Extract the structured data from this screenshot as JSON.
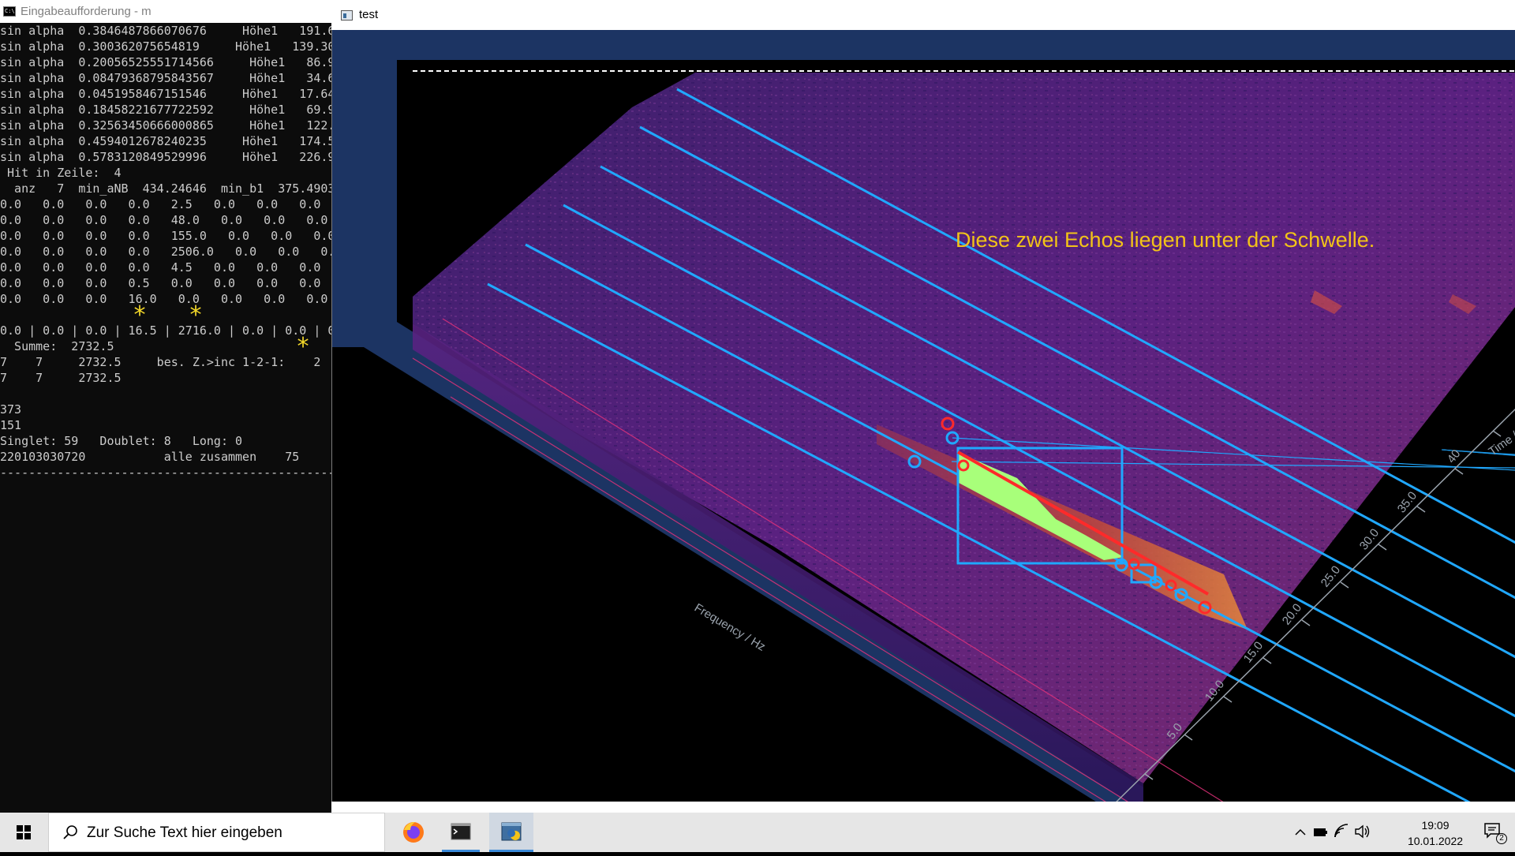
{
  "console": {
    "title": "Eingabeaufforderung - m",
    "lines": [
      "sin alpha  0.3846487866070676     Höhe1   191.6",
      "sin alpha  0.300362075654819     Höhe1   139.30",
      "sin alpha  0.20056525551714566     Höhe1   86.9",
      "sin alpha  0.08479368795843567     Höhe1   34.6",
      "sin alpha  0.0451958467151546     Höhe1   17.64",
      "sin alpha  0.18458221677722592     Höhe1   69.9",
      "sin alpha  0.32563450666000865     Höhe1   122.",
      "sin alpha  0.4594012678240235     Höhe1   174.5",
      "sin alpha  0.5783120849529996     Höhe1   226.9",
      " Hit in Zeile:  4",
      "  anz   7  min_aNB  434.24646  min_b1  375.4903",
      "0.0   0.0   0.0   0.0   2.5   0.0   0.0   0.0",
      "0.0   0.0   0.0   0.0   48.0   0.0   0.0   0.0",
      "0.0   0.0   0.0   0.0   155.0   0.0   0.0   0.0",
      "0.0   0.0   0.0   0.0   2506.0   0.0   0.0   0.",
      "0.0   0.0   0.0   0.0   4.5   0.0   0.0   0.0",
      "0.0   0.0   0.0   0.5   0.0   0.0   0.0   0.0",
      "0.0   0.0   0.0   16.0   0.0   0.0   0.0   0.0",
      "",
      "0.0 | 0.0 | 0.0 | 16.5 | 2716.0 | 0.0 | 0.0 | 0",
      "  Summe:  2732.5",
      "7    7     2732.5     bes. Z.>inc 1-2-1:    2",
      "7    7     2732.5",
      "",
      "373",
      "151",
      "Singlet: 59   Doublet: 8   Long: 0",
      "220103030720           alle zusammen    75",
      "-------------------------------------------------------"
    ],
    "stars": [
      "*",
      "*",
      "*"
    ]
  },
  "plot": {
    "window_title": "test",
    "annotation": "Diese zwei Echos liegen unter der Schwelle.",
    "x_axis_label": "Frequency / Hz",
    "time_axis_label": "Time /",
    "time_ticks": [
      "5.0",
      "10.0",
      "15.0",
      "20.0",
      "25.0",
      "30.0",
      "35.0",
      "40"
    ],
    "colors": {
      "annotation": "#f2c318",
      "lines": "#20a8ff",
      "pink_lines": "#e0317a",
      "marker": "#ff2a2a",
      "highlight": "#a8ff7a",
      "floor": "#1c3463"
    }
  },
  "taskbar": {
    "search_placeholder": "Zur Suche Text hier eingeben",
    "time": "19:09",
    "date": "10.01.2022",
    "notification_count": "2",
    "apps": [
      "firefox",
      "command-prompt",
      "python"
    ]
  }
}
